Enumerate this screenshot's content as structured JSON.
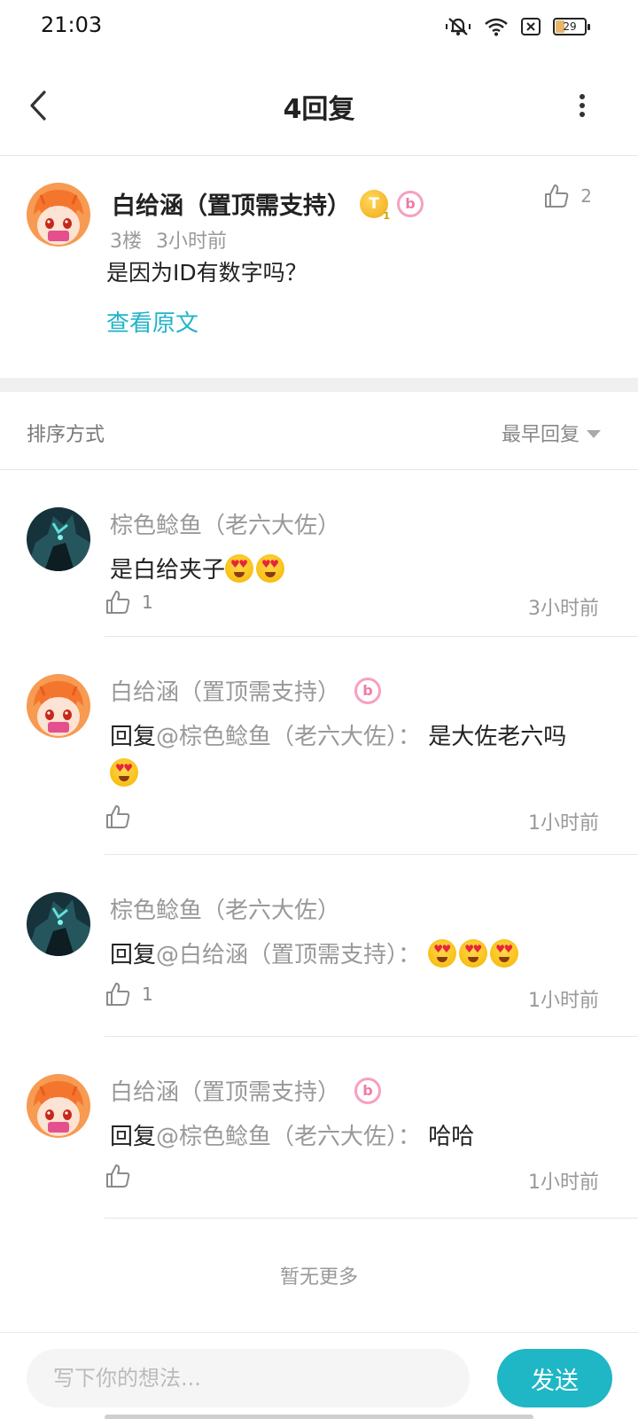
{
  "status_bar": {
    "time": "21:03",
    "battery": "29",
    "icons": [
      "mute-bell-icon",
      "wifi-icon",
      "sim-x-icon",
      "battery-icon"
    ]
  },
  "header": {
    "title": "4回复"
  },
  "post": {
    "author": "白给涵（置顶需支持）",
    "badge_t": "T",
    "badge_t_level": "1",
    "floor": "3楼",
    "time": "3小时前",
    "content": "是因为ID有数字吗？",
    "link": "查看原文",
    "like_count": "2"
  },
  "sort": {
    "label": "排序方式",
    "selected": "最早回复"
  },
  "replies": [
    {
      "author": "棕色鲶鱼（老六大佐）",
      "text": "是白给夹子",
      "emoji_count": 2,
      "like_count": "1",
      "time": "3小时前"
    },
    {
      "author": "白给涵（置顶需支持）",
      "mention": "回复@棕色鲶鱼（老六大佐）：",
      "text": "是大佐老六吗",
      "emoji_count": 1,
      "like_count": "",
      "time": "1小时前"
    },
    {
      "author": "棕色鲶鱼（老六大佐）",
      "mention": "回复@白给涵（置顶需支持）：",
      "text": "",
      "emoji_count": 3,
      "like_count": "1",
      "time": "1小时前"
    },
    {
      "author": "白给涵（置顶需支持）",
      "mention": "回复@棕色鲶鱼（老六大佐）：",
      "text": "哈哈",
      "emoji_count": 0,
      "like_count": "",
      "time": "1小时前"
    }
  ],
  "footer": {
    "no_more": "暂无更多"
  },
  "composer": {
    "placeholder": "写下你的想法...",
    "send_label": "发送"
  },
  "colors": {
    "accent": "#1fb6c6",
    "link": "#21b4c8",
    "muted": "#999999"
  }
}
